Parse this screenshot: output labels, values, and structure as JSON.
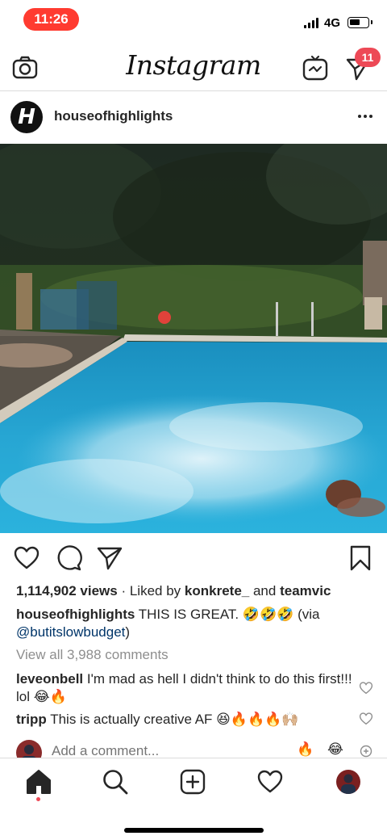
{
  "status_bar": {
    "time": "11:26",
    "network": "4G",
    "battery_level": 0.6
  },
  "top_nav": {
    "logo": "Instagram",
    "dm_badge": "11",
    "accent_color": "#ed4956"
  },
  "post": {
    "username": "houseofhighlights",
    "avatar_letter": "H",
    "views_count": "1,114,902 views",
    "liked_by_prefix": "· Liked by",
    "liked_by_user": "konkrete_",
    "liked_by_and": "and",
    "liked_by_user2": "teamvic",
    "caption_user": "houseofhighlights",
    "caption_text": "THIS IS GREAT. 🤣🤣🤣 (via",
    "caption_mention": "@butitslowbudget",
    "caption_close": ")",
    "view_all_comments": "View all 3,988 comments",
    "comments": [
      {
        "user": "leveonbell",
        "text": "I'm mad as hell I didn't think to do this first!!! lol 😂🔥"
      },
      {
        "user": "tripp",
        "text": "This is actually creative AF 😆🔥🔥🔥🙌🏼"
      }
    ],
    "add_comment_placeholder": "Add a comment...",
    "quick_reactions": [
      "🔥",
      "😂"
    ]
  },
  "icons": {
    "camera": "camera-icon",
    "igtv": "igtv-icon",
    "direct": "direct-message-icon",
    "like": "heart-icon",
    "comment": "comment-icon",
    "share": "share-icon",
    "save": "bookmark-icon",
    "home": "home-icon",
    "search": "search-icon",
    "new_post": "new-post-icon",
    "activity": "activity-heart-icon"
  }
}
